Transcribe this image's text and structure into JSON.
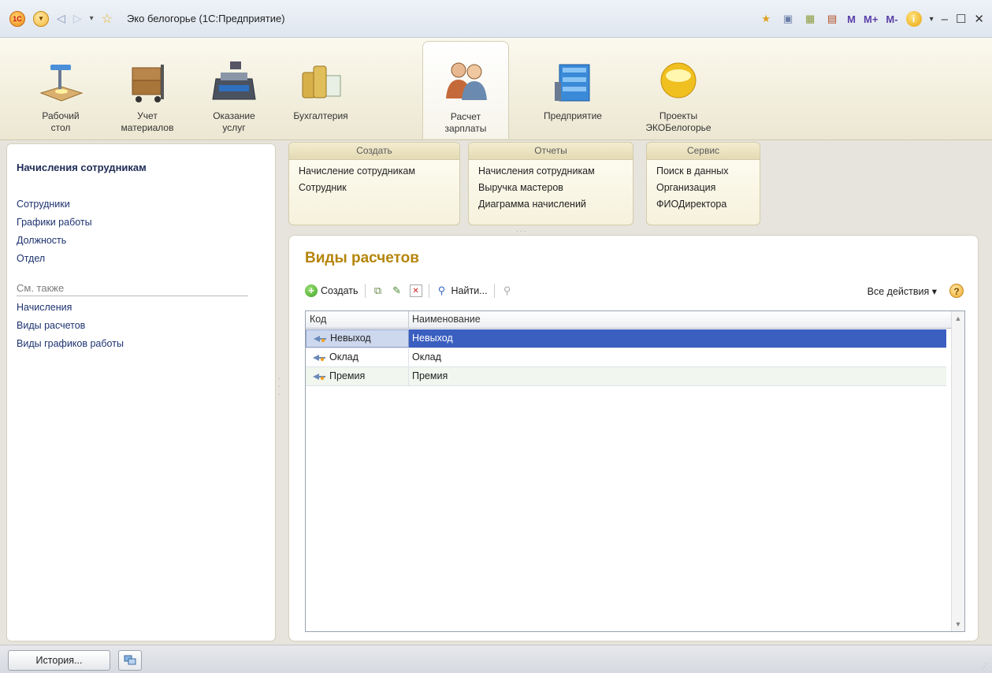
{
  "window": {
    "title": "Эко белогорье (1С:Предприятие)",
    "logo_text": "1С",
    "mem_m": "M",
    "mem_mplus": "M+",
    "mem_mminus": "M-"
  },
  "sections": [
    {
      "label": "Рабочий\nстол"
    },
    {
      "label": "Учет\nматериалов"
    },
    {
      "label": "Оказание\nуслуг"
    },
    {
      "label": "Бухгалтерия"
    },
    {
      "label": "Расчет\nзарплаты"
    },
    {
      "label": "Предприятие"
    },
    {
      "label": "Проекты\nЭКОБелогорье"
    }
  ],
  "left_panel": {
    "title": "Начисления сотрудникам",
    "links": [
      "Сотрудники",
      "Графики работы",
      "Должность",
      "Отдел"
    ],
    "see_also_header": "См. также",
    "see_also": [
      "Начисления",
      "Виды расчетов",
      "Виды графиков работы"
    ]
  },
  "command_groups": {
    "create": {
      "header": "Создать",
      "items": [
        "Начисление сотрудникам",
        "Сотрудник"
      ]
    },
    "reports": {
      "header": "Отчеты",
      "items": [
        "Начисления сотрудникам",
        "Выручка мастеров",
        "Диаграмма начислений"
      ]
    },
    "service": {
      "header": "Сервис",
      "items": [
        "Поиск в данных",
        "Организация",
        "ФИОДиректора"
      ]
    }
  },
  "form": {
    "title": "Виды расчетов",
    "toolbar": {
      "create_label": "Создать",
      "find_label": "Найти...",
      "all_actions_label": "Все действия ▾",
      "help_label": "?"
    },
    "columns": {
      "code": "Код",
      "name": "Наименование"
    },
    "rows": [
      {
        "code": "Невыход",
        "name": "Невыход"
      },
      {
        "code": "Оклад",
        "name": "Оклад"
      },
      {
        "code": "Премия",
        "name": "Премия"
      }
    ]
  },
  "bottom_bar": {
    "history_label": "История..."
  },
  "colors": {
    "form_title": "#b5850a",
    "selection": "#3a5fc0",
    "accent_link": "#1e3370"
  }
}
